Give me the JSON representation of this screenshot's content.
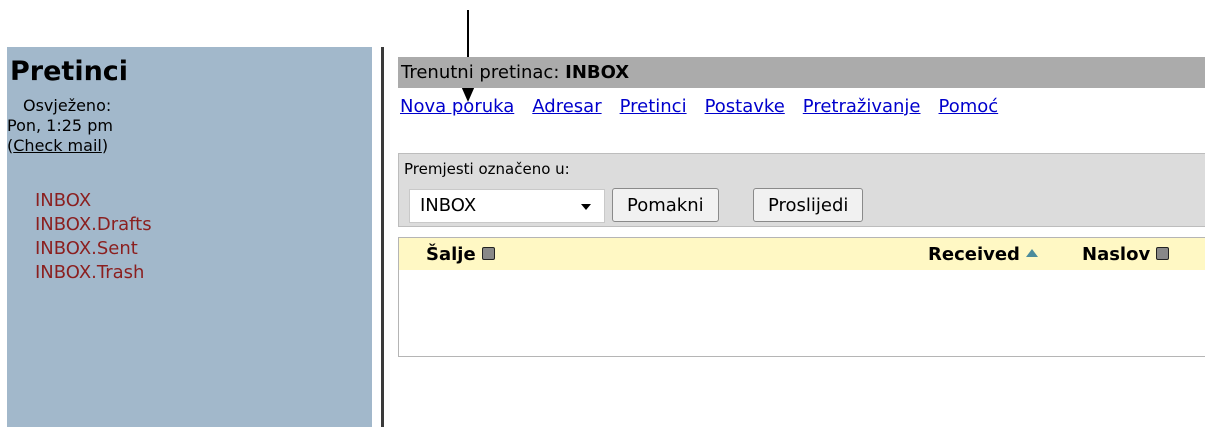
{
  "left": {
    "title": "Pretinci",
    "refresh_label": "Osvježeno:",
    "refresh_time": "Pon, 1:25 pm",
    "check_mail_open": "(",
    "check_mail_link": "Check mail",
    "check_mail_close": ")",
    "folders": [
      "INBOX",
      "INBOX.Drafts",
      "INBOX.Sent",
      "INBOX.Trash"
    ]
  },
  "header": {
    "current_label": "Trenutni pretinac: ",
    "current_folder": "INBOX"
  },
  "nav": [
    "Nova poruka",
    "Adresar",
    "Pretinci",
    "Postavke",
    "Pretraživanje",
    "Pomoć"
  ],
  "move": {
    "label": "Premjesti označeno u:",
    "selected": "INBOX",
    "move_button": "Pomakni",
    "forward_button": "Proslijedi"
  },
  "list": {
    "col_from": "Šalje",
    "col_received": "Received",
    "col_subject": "Naslov"
  },
  "colors": {
    "left_pane_bg": "#a2b8cb",
    "folder_link": "#8b1f1f",
    "nav_link": "#0000cc",
    "title_bar_bg": "#ababab",
    "list_header_bg": "#fff8c4"
  }
}
